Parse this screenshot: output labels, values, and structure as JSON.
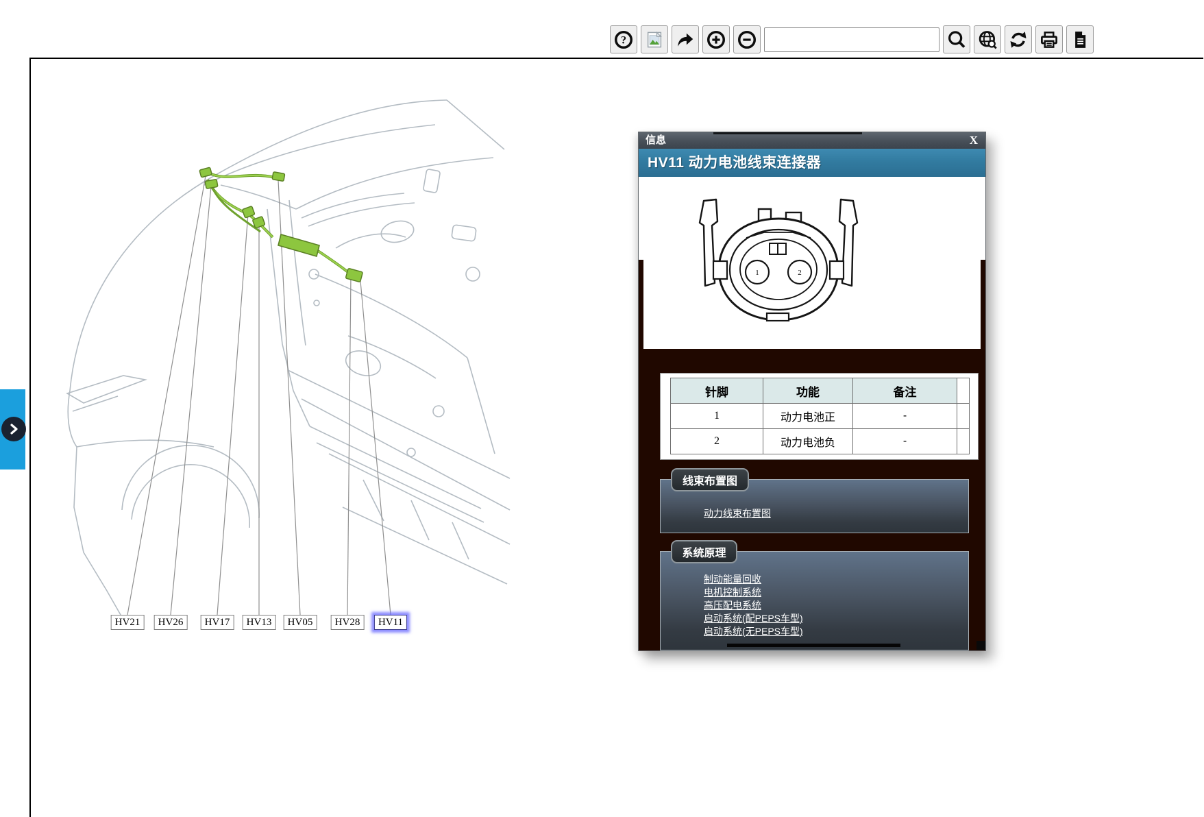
{
  "toolbar": {
    "search_input": {
      "value": "",
      "placeholder": ""
    },
    "buttons": [
      {
        "name": "help",
        "icon": "question-circle-icon"
      },
      {
        "name": "image",
        "icon": "image-placeholder-icon"
      },
      {
        "name": "share",
        "icon": "share-arrow-icon"
      },
      {
        "name": "zoom-in",
        "icon": "plus-circle-icon"
      },
      {
        "name": "zoom-out",
        "icon": "minus-circle-icon"
      },
      {
        "name": "search",
        "icon": "magnifier-icon"
      },
      {
        "name": "web-search",
        "icon": "globe-magnifier-icon"
      },
      {
        "name": "refresh",
        "icon": "sync-arrows-icon"
      },
      {
        "name": "print",
        "icon": "printer-icon"
      },
      {
        "name": "document",
        "icon": "document-page-icon"
      }
    ]
  },
  "side_tab": {
    "icon": "chevron-right-icon"
  },
  "diagram": {
    "labels": [
      {
        "text": "HV21",
        "selected": false
      },
      {
        "text": "HV26",
        "selected": false
      },
      {
        "text": "HV17",
        "selected": false
      },
      {
        "text": "HV13",
        "selected": false
      },
      {
        "text": "HV05",
        "selected": false
      },
      {
        "text": "HV28",
        "selected": false
      },
      {
        "text": "HV11",
        "selected": true
      }
    ]
  },
  "popup": {
    "title": "信息",
    "close_label": "X",
    "header": "HV11 动力电池线束连接器",
    "connector": {
      "pins": [
        "1",
        "2"
      ]
    },
    "pin_table": {
      "headers": [
        "针脚",
        "功能",
        "备注"
      ],
      "rows": [
        [
          "1",
          "动力电池正",
          "-"
        ],
        [
          "2",
          "动力电池负",
          "-"
        ]
      ]
    },
    "sections": [
      {
        "title": "线束布置图",
        "links": [
          "动力线束布置图"
        ]
      },
      {
        "title": "系统原理",
        "links": [
          "制动能量回收",
          "电机控制系统",
          "高压配电系统",
          "启动系统(配PEPS车型)",
          "启动系统(无PEPS车型)"
        ]
      }
    ]
  },
  "colors": {
    "header_blue": "#327ba0",
    "tab_blue": "#1b9fdd",
    "harness_green": "#8dc63f",
    "popup_dark_bg": "#200800",
    "table_header_bg": "#dbe9e9",
    "selected_glow": "#6464ff"
  }
}
